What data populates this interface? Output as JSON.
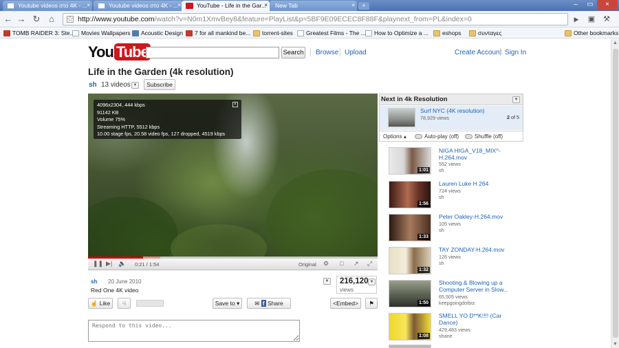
{
  "browser": {
    "tabs": [
      {
        "title": "Youtube videos στο 4K - ...",
        "close": "×"
      },
      {
        "title": "Youtube videos στο 4K - ...",
        "close": "×"
      },
      {
        "title": "YouTube - Life in the Gar...",
        "close": "×"
      },
      {
        "title": "New Tab",
        "close": "×"
      }
    ],
    "new_tab_glyph": "+",
    "window_controls": {
      "minimize": "–",
      "maximize": "▭",
      "close": "×"
    },
    "url_host": "http://www.youtube.com",
    "url_rest": "/watch?v=N0m1XmvBey8&feature=PlayList&p=5BF9E09ECEC8F88F&playnext_from=PL&index=0",
    "bookmarks": [
      "TOMB RAIDER 3: Ste...",
      "Movies Wallpapers",
      "Acoustic Design",
      "7 for all mankind be...",
      "torrent-sites",
      "Greatest Films - The ...",
      "How to Optimize a ...",
      "eshops",
      "συνταγες"
    ],
    "other_bookmarks": "Other bookmarks"
  },
  "header": {
    "logo_you": "You",
    "logo_tube": "Tube",
    "search_placeholder": "",
    "search_button": "Search",
    "browse": "Browse",
    "upload": "Upload",
    "create_account": "Create Account",
    "sign_in": "Sign In"
  },
  "video": {
    "title": "Life in the Garden (4k resolution)",
    "channel": "sh",
    "video_count": "13 videos",
    "subscribe": "Subscribe",
    "stats_lines": [
      "4096x2304, 444 kbps",
      "91142 KB",
      "Volume 75%",
      "Streaming HTTP, 5512 kbps",
      "10.00 stage fps, 20.58 video fps, 127 dropped, 4519 kbps"
    ],
    "progress_played": 0.19,
    "progress_buffered_to": 0.25,
    "time": "0:21 / 1:54",
    "quality": "Original",
    "date": "20 June 2010",
    "description": "Red One 4K video",
    "views": "216,120",
    "views_label": "views",
    "like": "Like",
    "save_to": "Save to",
    "share": "Share",
    "embed": "<Embed>",
    "comment_placeholder": "Respond to this video..."
  },
  "playlist": {
    "heading": "Next in 4k Resolution",
    "current_title": "Surf NYC (4K resolution)",
    "current_views": "78,929 views",
    "position": "2",
    "position_suffix": "of 5",
    "options": "Options",
    "autoplay": "Auto-play (off)",
    "shuffle": "Shuffle (off)"
  },
  "related": [
    {
      "title": "NIGA HIGA_V18_MIX^-H.264.mov",
      "views": "552 views",
      "user": "sh",
      "duration": "1:01"
    },
    {
      "title": "Lauren Luke H 264",
      "views": "724 views",
      "user": "sh",
      "duration": "1:56"
    },
    {
      "title": "Peter Oakley-H.264.mov",
      "views": "105 views",
      "user": "sh",
      "duration": "1:33"
    },
    {
      "title": "TAY ZONDAY-H.264.mov",
      "views": "126 views",
      "user": "sh",
      "duration": "1:32"
    },
    {
      "title": "Shooting & Blowing up a Computer Server in Slow...",
      "views": "65,505 views",
      "user": "keepgoingdotbiz",
      "duration": "1:50"
    },
    {
      "title": "SMELL YO D**K!!!! (Car Dance)",
      "views": "429,483 views",
      "user": "shane",
      "duration": "1:08"
    }
  ]
}
